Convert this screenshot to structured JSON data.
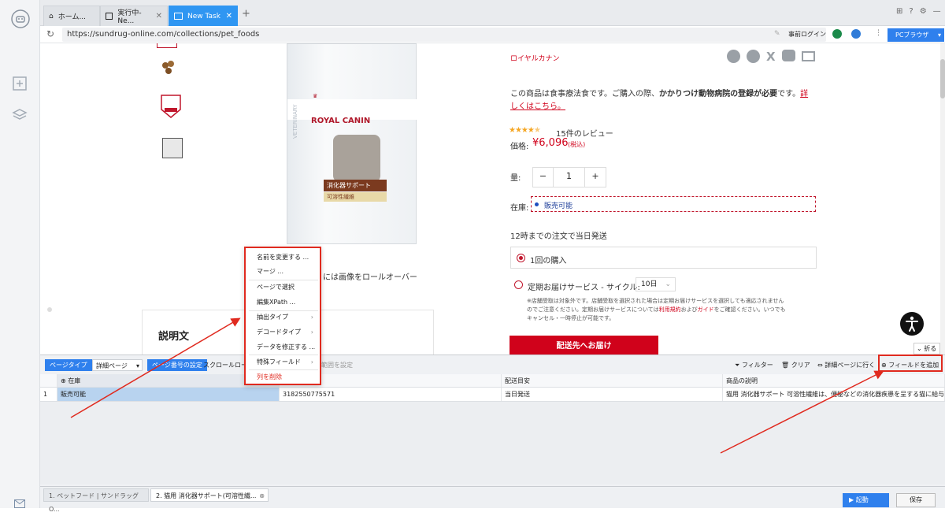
{
  "rail": {},
  "tabs": [
    {
      "label": "ホーム..."
    },
    {
      "label": "実行中-Ne..."
    },
    {
      "label": "New Task"
    }
  ],
  "address": {
    "url": "https://sundrug-online.com/collections/pet_foods",
    "login": "事前ログイン",
    "browser_btn": "PCブラウザ"
  },
  "product": {
    "brand": "ロイヤルカナン",
    "notice_part1": "この商品は食事療法食です。ご購入の際、",
    "notice_bold": "かかりつけ動物病院の登録が必要",
    "notice_part2": "です。",
    "notice_link": "詳しくはこちら。",
    "rating_value": 4.5,
    "reviews": "15件のレビュー",
    "price_label": "価格:",
    "price": "¥6,096",
    "price_tax": "(税込)",
    "qty_label": "量:",
    "qty_minus": "−",
    "qty_value": "1",
    "qty_plus": "+",
    "stock_label": "在庫:",
    "stock_value": "販売可能",
    "ship_note": "12時までの注文で当日発送",
    "option1": "1回の購入",
    "option2": "定期お届けサービス - サイクル:",
    "cycle": "10日",
    "note_line1": "※店舗受取は対象外です。店舗受取を選択された場合は定期お届けサービスを選択しても適応されません",
    "note_line2a": "のでご注意ください。定期お届けサービスについては",
    "note_link1": "利用規約",
    "note_line2b": "および",
    "note_link2": "ガイド",
    "note_line2c": "をご確認ください。いつでも",
    "note_line3": "キャンセル・一時停止が可能です。",
    "cart_btn": "配送先へお届け",
    "image_hint": "には画像をロールオーバー",
    "desc_title": "説明文",
    "package_brand": "ROYAL CANIN",
    "package_name": "消化器サポート",
    "package_sub": "可溶性繊維",
    "package_side": "VETERINARY"
  },
  "panel": {
    "page_type_btn": "ページタイプ",
    "page_type_value": "詳細ページ",
    "page_num_btn": "ページ番号の設定",
    "scroll_btn": "スクロールロー",
    "range_btn": "範囲を設定",
    "filter": "フィルター",
    "clear": "クリア",
    "goto_detail": "詳細ページに行く",
    "add_field": "フィールドを追加",
    "fold": "折る",
    "columns": [
      "在庫",
      "",
      "配送目安",
      "商品の説明"
    ],
    "row_index": "1",
    "row": [
      "販売可能",
      "3182550775571",
      "当日発送",
      "猫用 消化器サポート 可溶性繊維は、便秘などの消化器疾患を呈する猫に給与す..."
    ]
  },
  "context_menu": {
    "items": [
      "名前を変更する ...",
      "マージ ...",
      "ページで選択",
      "編集XPath ...",
      "抽出タイプ",
      "デコードタイプ",
      "データを修正する ...",
      "特殊フィールド",
      "列を削除"
    ]
  },
  "bottom_tabs": [
    {
      "label": "1. ペットフード | サンドラッグ O..."
    },
    {
      "label": "2. 猫用 消化器サポート(可溶性繊..."
    }
  ],
  "actions": {
    "run": "起動",
    "save": "保存"
  },
  "colors": {
    "accent": "#2f80ed",
    "brand_red": "#c0162c",
    "highlight_red": "#e02a1f"
  }
}
